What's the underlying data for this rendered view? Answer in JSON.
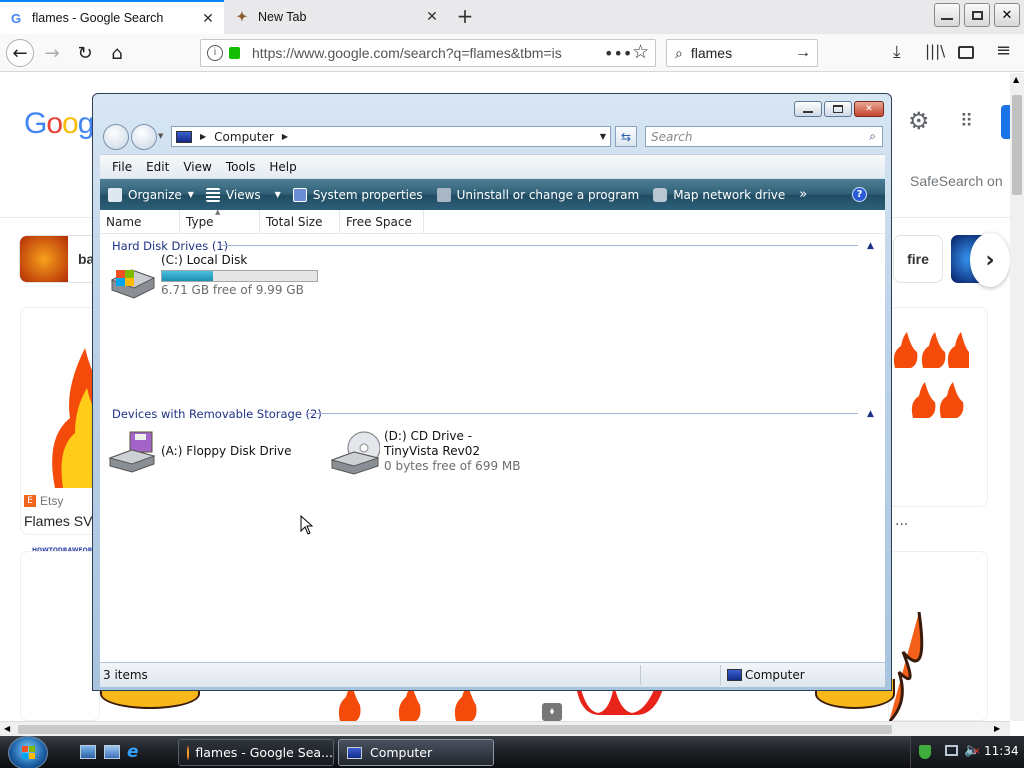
{
  "browser": {
    "tabs": [
      {
        "title": "flames - Google Search",
        "active": true,
        "favicon": "google-g-icon"
      },
      {
        "title": "New Tab",
        "active": false,
        "favicon": "tab-image-icon"
      }
    ],
    "url": "https://www.google.com/search?q=flames&tbm=is",
    "search_value": "flames",
    "new_tab_label": "+"
  },
  "google": {
    "logo_text": "Goog",
    "safesearch": "SafeSearch on",
    "chip_left": "ba",
    "chip_right": "fire",
    "result_source": "Etsy",
    "result_title": "Flames SV",
    "ellipsis": "...",
    "small_watermark": "HOWTODRAWFOR"
  },
  "explorer": {
    "breadcrumb": "Computer",
    "search_placeholder": "Search",
    "menu": [
      "File",
      "Edit",
      "View",
      "Tools",
      "Help"
    ],
    "commands": [
      "Organize",
      "Views",
      "System properties",
      "Uninstall or change a program",
      "Map network drive"
    ],
    "more_chevron": "»",
    "columns": [
      "Name",
      "Type",
      "Total Size",
      "Free Space"
    ],
    "groups": [
      {
        "title": "Hard Disk Drives (1)",
        "items": [
          {
            "name": "(C:) Local Disk",
            "detail": "6.71 GB free of 9.99 GB",
            "used_fraction": 0.33,
            "icon": "hard-drive-icon"
          }
        ]
      },
      {
        "title": "Devices with Removable Storage (2)",
        "items": [
          {
            "name": "(A:) Floppy Disk Drive",
            "icon": "floppy-drive-icon"
          },
          {
            "name": "(D:) CD Drive - TinyVista Rev02",
            "detail": "0 bytes free of 699 MB",
            "icon": "cd-drive-icon"
          }
        ]
      }
    ],
    "status_items": "3 items",
    "status_location": "Computer"
  },
  "taskbar": {
    "buttons": [
      {
        "label": "flames - Google Sea...",
        "active": false
      },
      {
        "label": "Computer",
        "active": true
      }
    ],
    "clock": "11:34"
  }
}
